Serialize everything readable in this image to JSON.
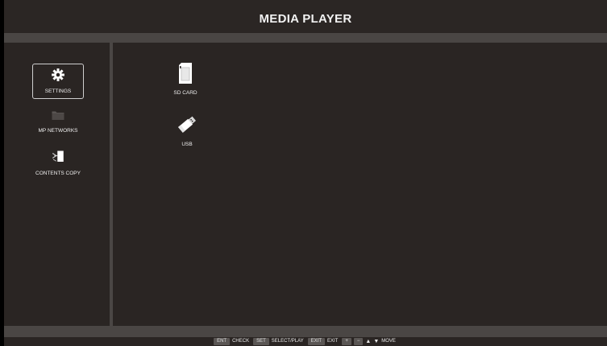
{
  "header": {
    "title": "MEDIA PLAYER"
  },
  "sidebar": {
    "items": [
      {
        "label": "SETTINGS",
        "icon": "gear-icon",
        "selected": true
      },
      {
        "label": "MP NETWORKS",
        "icon": "folder-icon",
        "selected": false
      },
      {
        "label": "CONTENTS COPY",
        "icon": "copy-icon",
        "selected": false
      }
    ]
  },
  "main": {
    "items": [
      {
        "label": "SD CARD",
        "icon": "sd-card-icon"
      },
      {
        "label": "USB",
        "icon": "usb-drive-icon"
      }
    ]
  },
  "footer": {
    "key_ent": "ENT",
    "label_check": "CHECK",
    "key_set": "SET",
    "label_select_play": "SELECT/PLAY",
    "key_exit": "EXIT",
    "label_exit": "EXIT",
    "key_plus": "+",
    "key_minus": "−",
    "arrow_up": "▲",
    "arrow_down": "▼",
    "label_move": "MOVE"
  },
  "colors": {
    "background": "#2a2523",
    "strip": "#4a4644",
    "text": "#f0f0f0"
  }
}
